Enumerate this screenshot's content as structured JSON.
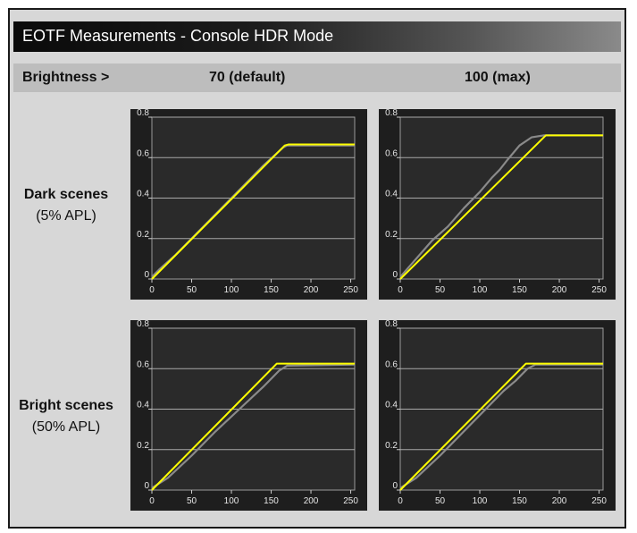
{
  "title": "EOTF Measurements - Console HDR Mode",
  "header": {
    "brightness_label": "Brightness >",
    "col1": "70 (default)",
    "col2": "100 (max)"
  },
  "rows": [
    {
      "label": "Dark scenes",
      "sublabel": "(5% APL)"
    },
    {
      "label": "Bright scenes",
      "sublabel": "(50% APL)"
    }
  ],
  "colors": {
    "target_line": "#ffff00",
    "measured_line": "#8a8a8a",
    "plot_bg": "#2a2a2a"
  },
  "chart_data": [
    {
      "type": "line",
      "panel": "dark-default",
      "xlim": [
        0,
        255
      ],
      "ylim": [
        0,
        0.8
      ],
      "xticks": [
        0,
        50,
        100,
        150,
        200,
        250
      ],
      "yticks": [
        0,
        0.2,
        0.4,
        0.6,
        0.8
      ],
      "ytick_labels": [
        "0",
        "0.2",
        "0.4",
        "0.6",
        "0.8"
      ],
      "grid": true,
      "series": [
        {
          "role": "target",
          "x": [
            0,
            167,
            172,
            255
          ],
          "y": [
            0,
            0.66,
            0.665,
            0.665
          ]
        },
        {
          "role": "measured",
          "x": [
            0,
            10,
            30,
            60,
            100,
            140,
            165,
            170,
            255
          ],
          "y": [
            0.01,
            0.05,
            0.12,
            0.24,
            0.4,
            0.56,
            0.65,
            0.66,
            0.66
          ]
        }
      ]
    },
    {
      "type": "line",
      "panel": "dark-max",
      "xlim": [
        0,
        255
      ],
      "ylim": [
        0,
        0.8
      ],
      "xticks": [
        0,
        50,
        100,
        150,
        200,
        250
      ],
      "yticks": [
        0,
        0.2,
        0.4,
        0.6,
        0.8
      ],
      "ytick_labels": [
        "0",
        "0.2",
        "0.4",
        "0.6",
        "0.8"
      ],
      "grid": true,
      "series": [
        {
          "role": "target",
          "x": [
            0,
            183,
            255
          ],
          "y": [
            0,
            0.71,
            0.71
          ]
        },
        {
          "role": "measured",
          "x": [
            0,
            20,
            40,
            60,
            80,
            100,
            115,
            125,
            135,
            150,
            165,
            180,
            255
          ],
          "y": [
            0.01,
            0.1,
            0.19,
            0.26,
            0.35,
            0.43,
            0.5,
            0.54,
            0.59,
            0.66,
            0.7,
            0.71,
            0.71
          ]
        }
      ]
    },
    {
      "type": "line",
      "panel": "bright-default",
      "xlim": [
        0,
        255
      ],
      "ylim": [
        0,
        0.8
      ],
      "xticks": [
        0,
        50,
        100,
        150,
        200,
        250
      ],
      "yticks": [
        0,
        0.2,
        0.4,
        0.6,
        0.8
      ],
      "ytick_labels": [
        "0",
        "0.2",
        "0.4",
        "0.6",
        "0.8"
      ],
      "grid": true,
      "series": [
        {
          "role": "target",
          "x": [
            0,
            157,
            255
          ],
          "y": [
            0,
            0.625,
            0.625
          ]
        },
        {
          "role": "measured",
          "x": [
            0,
            20,
            50,
            80,
            110,
            140,
            160,
            170,
            255
          ],
          "y": [
            0.01,
            0.06,
            0.17,
            0.29,
            0.4,
            0.51,
            0.59,
            0.615,
            0.62
          ]
        }
      ]
    },
    {
      "type": "line",
      "panel": "bright-max",
      "xlim": [
        0,
        255
      ],
      "ylim": [
        0,
        0.8
      ],
      "xticks": [
        0,
        50,
        100,
        150,
        200,
        250
      ],
      "yticks": [
        0,
        0.2,
        0.4,
        0.6,
        0.8
      ],
      "ytick_labels": [
        "0",
        "0.2",
        "0.4",
        "0.6",
        "0.8"
      ],
      "grid": true,
      "series": [
        {
          "role": "target",
          "x": [
            0,
            158,
            255
          ],
          "y": [
            0,
            0.625,
            0.625
          ]
        },
        {
          "role": "measured",
          "x": [
            0,
            20,
            50,
            80,
            110,
            130,
            145,
            160,
            170,
            255
          ],
          "y": [
            0.01,
            0.06,
            0.17,
            0.29,
            0.41,
            0.49,
            0.54,
            0.6,
            0.62,
            0.62
          ]
        }
      ]
    }
  ]
}
